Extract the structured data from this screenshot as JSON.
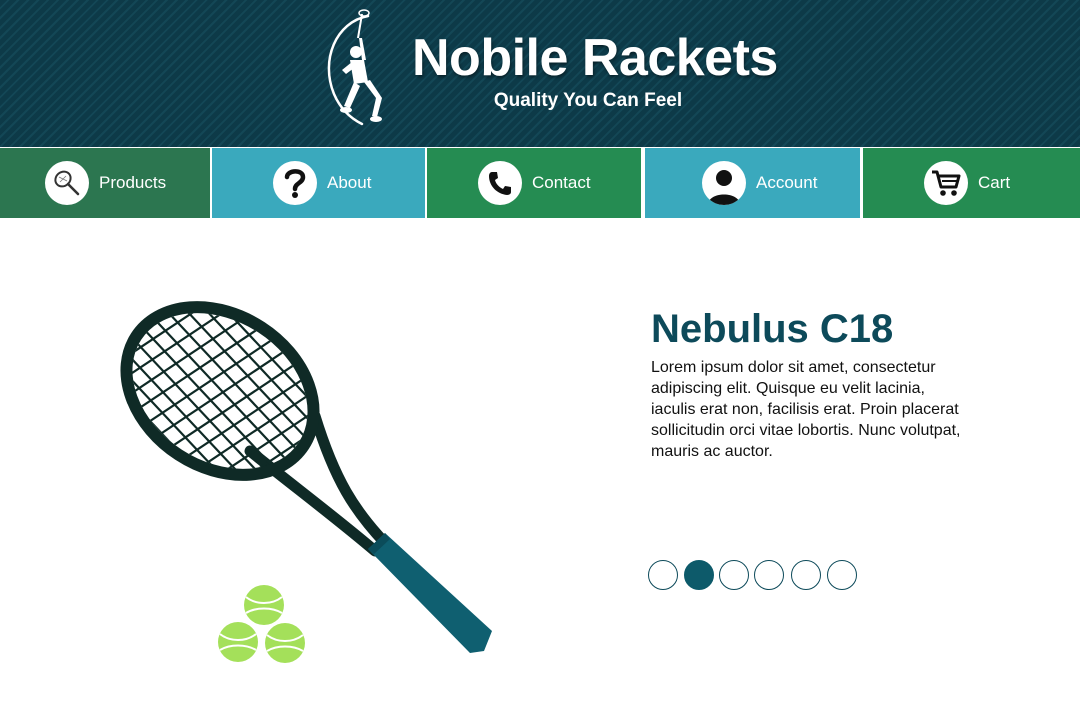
{
  "header": {
    "title": "Nobile Rackets",
    "tagline": "Quality You Can Feel",
    "logo_icon": "tennis-player-icon"
  },
  "nav": {
    "items": [
      {
        "label": "Products",
        "icon": "racket-icon",
        "color": "#2c7650",
        "active": true
      },
      {
        "label": "About",
        "icon": "question-icon",
        "color": "#3aa9bd"
      },
      {
        "label": "Contact",
        "icon": "phone-icon",
        "color": "#258c52"
      },
      {
        "label": "Account",
        "icon": "user-icon",
        "color": "#3aa9bd"
      },
      {
        "label": "Cart",
        "icon": "cart-icon",
        "color": "#258c52"
      }
    ]
  },
  "product": {
    "name": "Nebulus C18",
    "description": "Lorem ipsum dolor sit amet, consectetur adipiscing elit. Quisque eu velit lacinia, iaculis erat non, facilisis erat. Proin placerat sollicitudin orci vitae lobortis. Nunc volutpat, mauris ac auctor.",
    "image": "tennis-racket-image",
    "accent_color": "#0d4a5a"
  },
  "carousel": {
    "count": 6,
    "active_index": 1
  },
  "colors": {
    "header_bg": "#0d3a48",
    "nav_green": "#258c52",
    "nav_blue": "#3aa9bd",
    "racket_frame": "#0f2a26",
    "racket_grip": "#0f5f70",
    "ball": "#a4e05a"
  }
}
